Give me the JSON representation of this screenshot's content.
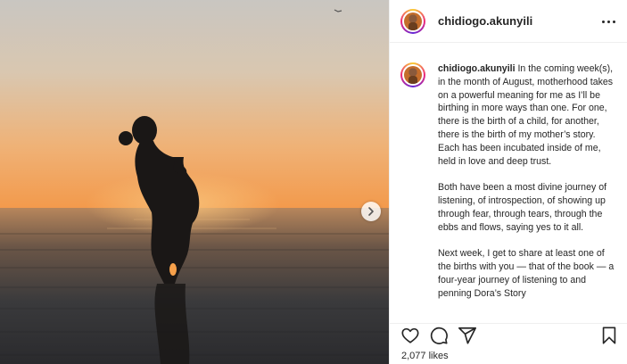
{
  "post": {
    "username": "chidiogo.akunyili",
    "caption": {
      "username": "chidiogo.akunyili",
      "paragraphs": [
        "In the coming week(s), in the month of August, motherhood takes on a powerful meaning for me as I’ll be birthing in more ways than one. For one, there is the birth of a child, for another, there is the birth of my mother’s story. Each has been incubated inside of me, held in love and deep trust.",
        "Both have been a most divine journey of listening, of introspection, of showing up through fear, through tears, through the ebbs and flows, saying yes to it all.",
        "Next week, I get to share at least one of the births with you — that of the book — a four-year journey of listening to and penning Dora’s Story"
      ]
    },
    "likes_text": "2,077 likes"
  },
  "icons": {
    "like": "heart-icon",
    "comment": "comment-icon",
    "share": "paper-plane-icon",
    "save": "bookmark-icon",
    "more": "more-icon",
    "next": "chevron-right-icon"
  },
  "colors": {
    "sky_top": "#c7c3bd",
    "sky_horizon": "#f2a45a",
    "sun_glow": "#f7b565",
    "water": "#2f2f33",
    "text": "#262626",
    "border": "#efefef"
  }
}
